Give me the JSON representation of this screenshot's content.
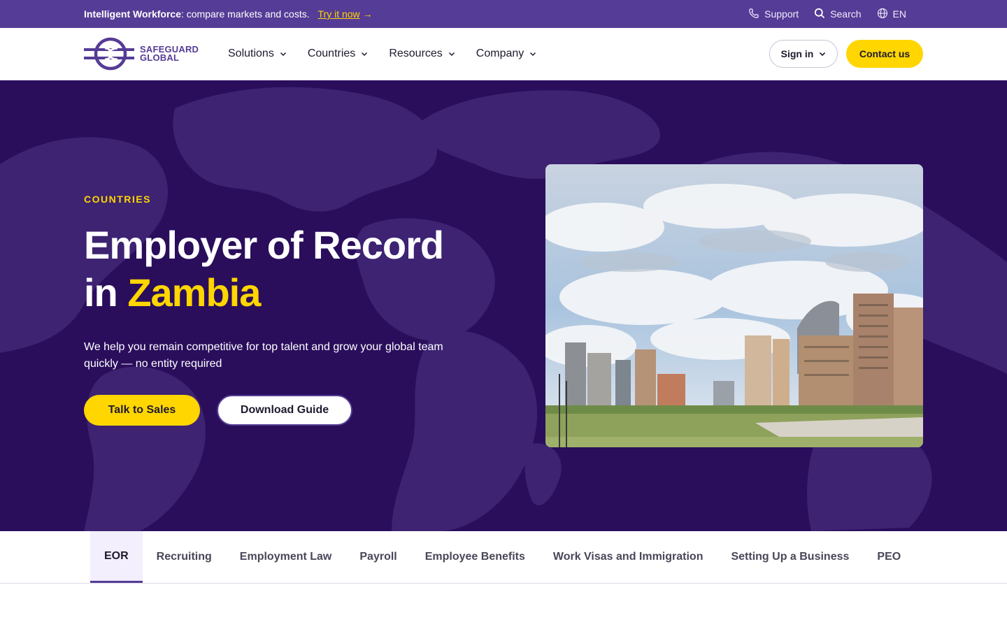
{
  "topbar": {
    "promo_bold": "Intelligent Workforce",
    "promo_text": ": compare markets and costs.",
    "try_label": "Try it now",
    "support_label": "Support",
    "search_label": "Search",
    "lang_label": "EN"
  },
  "nav": {
    "logo_line1": "SAFEGUARD",
    "logo_line2": "GLOBAL",
    "items": [
      {
        "label": "Solutions"
      },
      {
        "label": "Countries"
      },
      {
        "label": "Resources"
      },
      {
        "label": "Company"
      }
    ],
    "signin_label": "Sign in",
    "contact_label": "Contact us"
  },
  "hero": {
    "eyebrow": "COUNTRIES",
    "title_line1": "Employer of Record",
    "title_prefix": "in ",
    "title_highlight": "Zambia",
    "subtitle": "We help you remain competitive for top talent and grow your global team quickly — no entity required",
    "cta_primary": "Talk to Sales",
    "cta_secondary": "Download Guide"
  },
  "tabs": [
    {
      "label": "EOR",
      "active": true
    },
    {
      "label": "Recruiting"
    },
    {
      "label": "Employment Law"
    },
    {
      "label": "Payroll"
    },
    {
      "label": "Employee Benefits"
    },
    {
      "label": "Work Visas and Immigration"
    },
    {
      "label": "Setting Up a Business"
    },
    {
      "label": "PEO"
    }
  ],
  "colors": {
    "brand_purple": "#553c96",
    "hero_bg": "#2a0e5c",
    "accent_yellow": "#ffd600"
  }
}
